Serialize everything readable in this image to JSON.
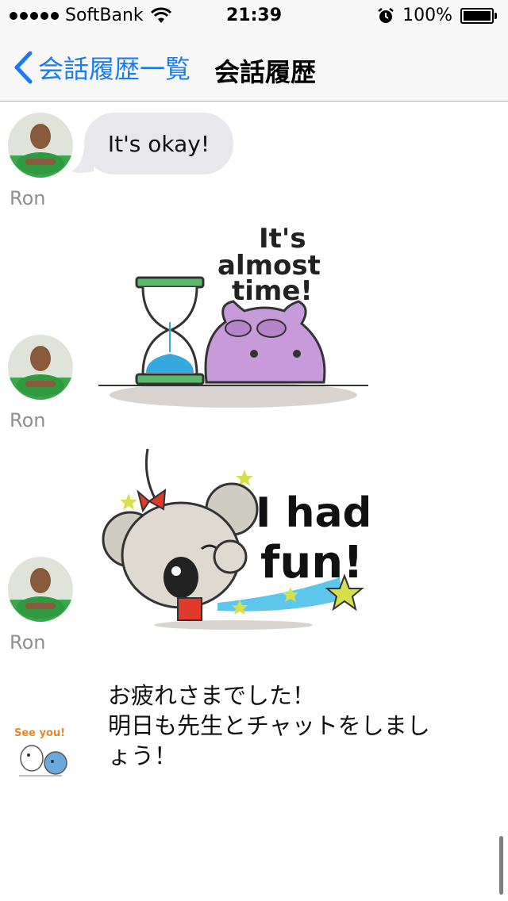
{
  "status_bar": {
    "carrier": "SoftBank",
    "time": "21:39",
    "battery": "100%",
    "battery_level": 1.0,
    "signal_bars": 5,
    "icons": [
      "signal-dots-icon",
      "wifi-icon",
      "alarm-clock-icon",
      "battery-icon"
    ]
  },
  "nav": {
    "back_label": "会話履歴一覧",
    "title": "会話履歴"
  },
  "messages": [
    {
      "sender": "Ron",
      "type": "text",
      "text": "It's okay!"
    },
    {
      "sender": "Ron",
      "type": "sticker",
      "sticker": "hourglass-hippo-sticker",
      "sticker_text": [
        "It's",
        "almost",
        "time!"
      ]
    },
    {
      "sender": "Ron",
      "type": "sticker",
      "sticker": "koala-fun-sticker",
      "sticker_text": [
        "I had",
        "fun!"
      ]
    },
    {
      "sender": "",
      "type": "text",
      "avatar_sticker": "see-you-sticker",
      "avatar_text": "See you!",
      "text": "お疲れさまでした！\n明日も先生とチャットをしましょう！",
      "lines": [
        "お疲れさまでした！",
        "明日も先生とチャットをしまし",
        "ょう！"
      ]
    }
  ],
  "colors": {
    "accent": "#1a7cf4",
    "bubble": "#e8e8ec",
    "name": "#8e8e93"
  }
}
